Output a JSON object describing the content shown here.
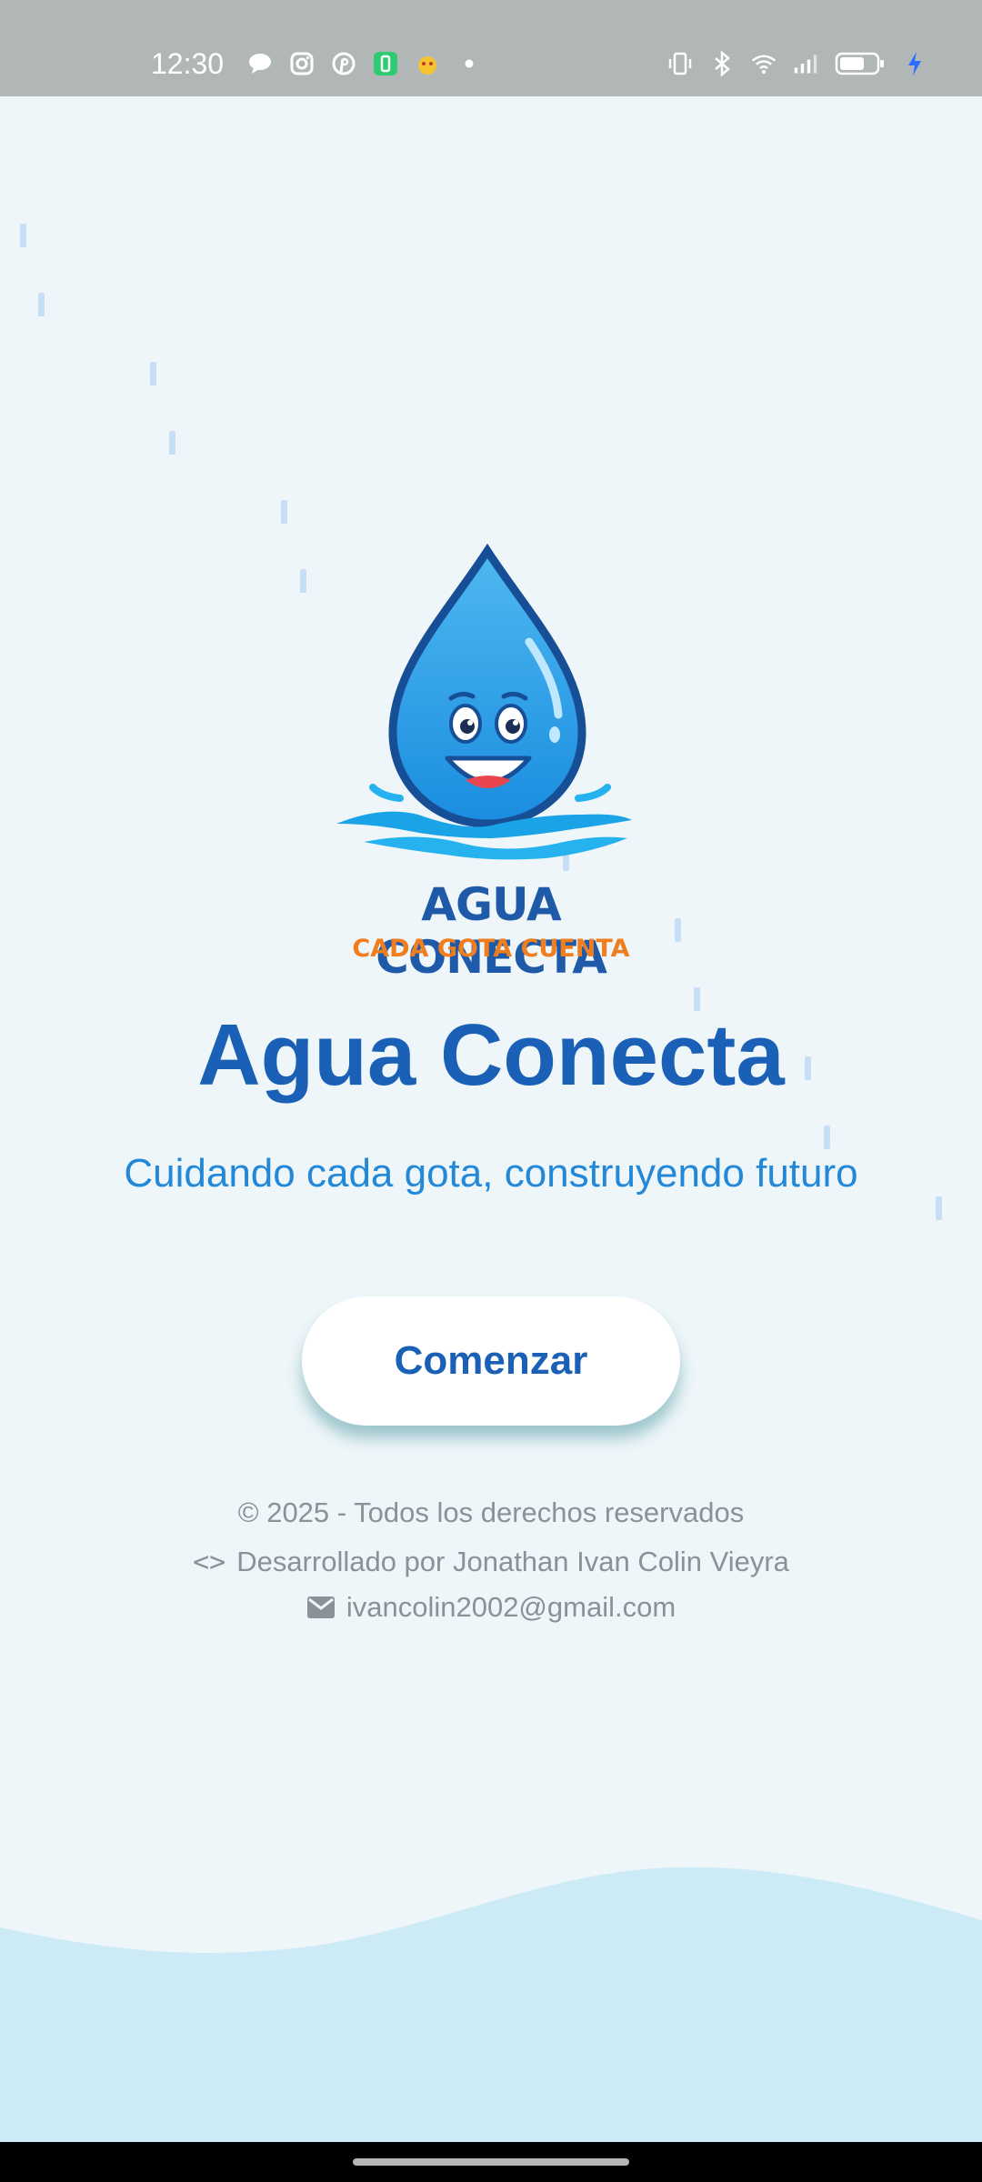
{
  "status_bar": {
    "time": "12:30",
    "left_icons": [
      "chat-bubble-icon",
      "instagram-icon",
      "pinterest-icon",
      "battery-app-icon",
      "fun-app-icon",
      "dot-icon"
    ],
    "right_icons": [
      "vibrate-icon",
      "bluetooth-icon",
      "wifi-icon",
      "signal-icon",
      "battery-icon",
      "charging-icon"
    ]
  },
  "logo": {
    "title": "AGUA CONECTA",
    "subtitle": "CADA GOTA CUENTA",
    "icon": "water-drop-mascot-icon"
  },
  "main": {
    "title": "Agua Conecta",
    "tagline": "Cuidando cada gota, construyendo futuro",
    "start_button_label": "Comenzar"
  },
  "footer": {
    "copyright": "© 2025 - Todos los derechos reservados",
    "developer": "Desarrollado por Jonathan Ivan Colin Vieyra",
    "email": "ivancolin2002@gmail.com",
    "developer_icon": "code-icon",
    "email_icon": "mail-icon"
  },
  "colors": {
    "background": "#eef6f9",
    "primary": "#1960b6",
    "accent": "#2488d8",
    "logo_orange": "#f07e1f",
    "wave": "#cdebf6"
  }
}
